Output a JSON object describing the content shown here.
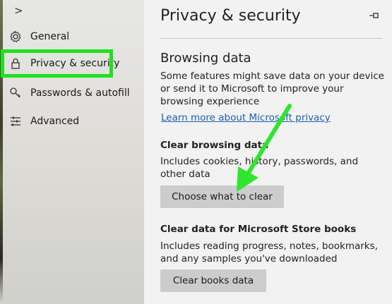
{
  "sidebar": {
    "expand_glyph": ">",
    "items": [
      {
        "label": "General",
        "icon": "gear-icon"
      },
      {
        "label": "Privacy & security",
        "icon": "lock-icon"
      },
      {
        "label": "Passwords & autofill",
        "icon": "key-icon"
      },
      {
        "label": "Advanced",
        "icon": "sliders-icon"
      }
    ]
  },
  "main": {
    "title": "Privacy & security",
    "browsing_data": {
      "title": "Browsing data",
      "description": "Some features might save data on your device or send it to Microsoft to improve your browsing experience",
      "link": "Learn more about Microsoft privacy"
    },
    "clear_browsing": {
      "title": "Clear browsing data",
      "description": "Includes cookies, history, passwords, and other data",
      "button": "Choose what to clear"
    },
    "clear_books": {
      "title": "Clear data for Microsoft Store books",
      "description": "Includes reading progress, notes, bookmarks, and any samples you've downloaded",
      "button": "Clear books data"
    }
  },
  "colors": {
    "highlight": "#1fe01f",
    "arrow": "#2ee62e",
    "link": "#1a5fb4",
    "button": "#cccccc"
  }
}
